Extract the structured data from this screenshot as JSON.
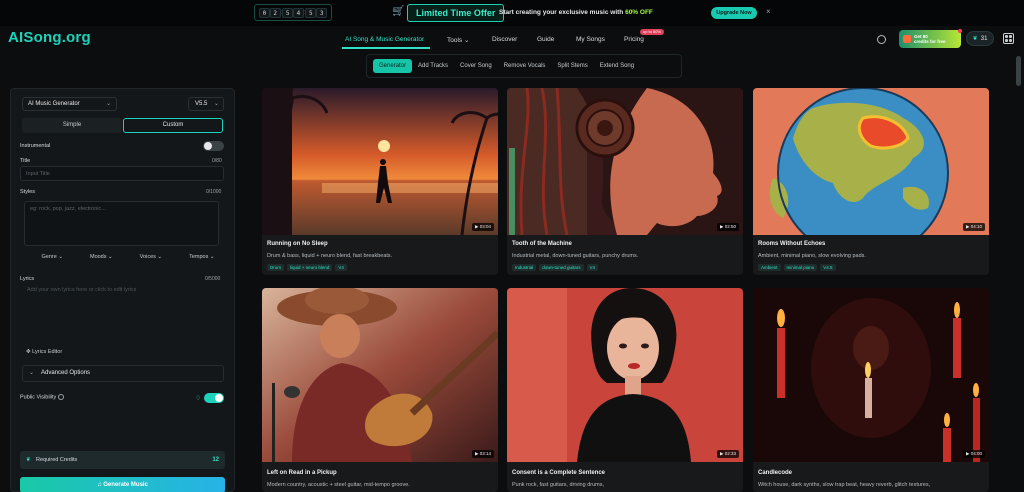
{
  "promo": {
    "countdown": [
      "0",
      "2",
      "5",
      "4",
      "5",
      "3"
    ],
    "offer": "Limited Time Offer",
    "text_prefix": "Start creating your exclusive music with ",
    "text_pct": "60% OFF",
    "upgrade": "Upgrade Now",
    "close": "×"
  },
  "nav": {
    "logo": "AISong.org",
    "items": [
      "AI Song & Music Generator",
      "Tools",
      "Discover",
      "Guide",
      "My Songs",
      "Pricing"
    ],
    "tools_chevron": "⌄",
    "hot_badge": "up to 60%",
    "credits_line1": "Get 80",
    "credits_line2": "credits for free",
    "coin_value": "31"
  },
  "subtabs": [
    "Generator",
    "Add Tracks",
    "Cover Song",
    "Remove Vocals",
    "Split Stems",
    "Extend Song"
  ],
  "panel": {
    "generator": "AI Music Generator",
    "version": "V5.5",
    "simple": "Simple",
    "custom": "Custom",
    "instrumental": "Instrumental",
    "title_label": "Title",
    "title_count": "0/80",
    "title_placeholder": "Input Title",
    "styles_label": "Styles",
    "styles_count": "0/1000",
    "styles_placeholder": "eg: rock, pop, jazz, electronic...",
    "chips": [
      "Genre",
      "Moods",
      "Voices",
      "Tempos"
    ],
    "lyrics_label": "Lyrics",
    "lyrics_count": "0/5000",
    "lyrics_placeholder": "Add your own lyrics here or click to edit lyrics",
    "lyrics_editor": "Lyrics Editor",
    "advanced": "Advanced Options",
    "visibility": "Public Visibility",
    "required_credits_label": "Required Credits",
    "required_credits_value": "12",
    "generate": "Generate Music"
  },
  "cards": [
    {
      "title": "Running on No Sleep",
      "desc": "Drum & bass, liquid + neuro blend, fast breakbeats.",
      "tags": [
        "Drum",
        "liquid + neuro blend",
        "V4"
      ],
      "duration": "03:04"
    },
    {
      "title": "Tooth of the Machine",
      "desc": "Industrial metal, down-tuned guitars, punchy drums.",
      "tags": [
        "Industrial",
        "down-tuned guitars",
        "V4"
      ],
      "duration": "02:50"
    },
    {
      "title": "Rooms Without Echoes",
      "desc": "Ambient, minimal piano, slow evolving pads.",
      "tags": [
        "Ambient",
        "minimal piano",
        "V4.5"
      ],
      "duration": "04:10"
    },
    {
      "title": "Left on Read in a Pickup",
      "desc": "Modern country, acoustic + steel guitar, mid-tempo groove.",
      "tags": [],
      "duration": "03:14"
    },
    {
      "title": "Consent is a Complete Sentence",
      "desc": "Punk rock, fast guitars, driving drums,",
      "tags": [],
      "duration": "02:33"
    },
    {
      "title": "Candlecode",
      "desc": "Witch house, dark synths, slow trap beat, heavy reverb, glitch textures,",
      "tags": [],
      "duration": "04:00"
    }
  ],
  "colors": {
    "accent": "#1ed3bb",
    "bg": "#0b0d0f",
    "panel": "#141719"
  }
}
